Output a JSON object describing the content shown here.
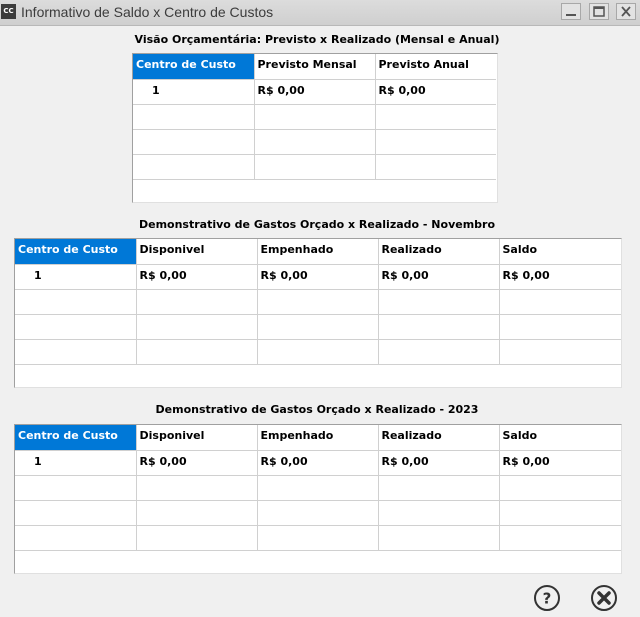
{
  "window": {
    "icon_label": "CC",
    "title": "Informativo de Saldo x Centro de Custos"
  },
  "section1": {
    "title": "Visão Orçamentária: Previsto x Realizado (Mensal e Anual)",
    "headers": [
      "Centro de Custo",
      "Previsto Mensal",
      "Previsto Anual"
    ],
    "rows": [
      [
        "1",
        "R$ 0,00",
        "R$ 0,00"
      ],
      [
        "",
        "",
        ""
      ],
      [
        "",
        "",
        ""
      ],
      [
        "",
        "",
        ""
      ]
    ]
  },
  "section2": {
    "title": "Demonstrativo de Gastos Orçado x Realizado - Novembro",
    "headers": [
      "Centro de Custo",
      "Disponivel",
      "Empenhado",
      "Realizado",
      "Saldo"
    ],
    "rows": [
      [
        "1",
        "R$ 0,00",
        "R$ 0,00",
        "R$ 0,00",
        "R$ 0,00"
      ],
      [
        "",
        "",
        "",
        "",
        ""
      ],
      [
        "",
        "",
        "",
        "",
        ""
      ],
      [
        "",
        "",
        "",
        "",
        ""
      ]
    ]
  },
  "section3": {
    "title": "Demonstrativo de Gastos Orçado x Realizado - 2023",
    "headers": [
      "Centro de Custo",
      "Disponivel",
      "Empenhado",
      "Realizado",
      "Saldo"
    ],
    "rows": [
      [
        "1",
        "R$ 0,00",
        "R$ 0,00",
        "R$ 0,00",
        "R$ 0,00"
      ],
      [
        "",
        "",
        "",
        "",
        ""
      ],
      [
        "",
        "",
        "",
        "",
        ""
      ],
      [
        "",
        "",
        "",
        "",
        ""
      ]
    ]
  },
  "buttons": {
    "help_icon": "question-circle-icon",
    "close_icon": "close-circle-icon"
  },
  "colors": {
    "selected_header": "#0078d7",
    "background": "#f0f0f0"
  }
}
